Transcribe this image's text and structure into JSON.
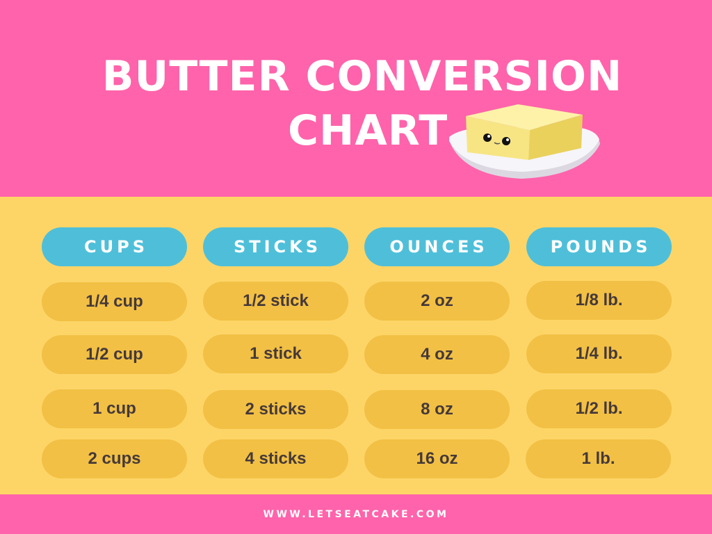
{
  "title": {
    "line1": "BUTTER CONVERSION",
    "line2": "CHART"
  },
  "illustration": "butter-on-plate-icon",
  "colors": {
    "header_bg": "#ff63ab",
    "body_bg": "#fdd567",
    "column_header_bg": "#4fbfd9",
    "cell_bg": "#f2c044",
    "cell_text": "#45393a"
  },
  "table": {
    "columns": [
      "CUPS",
      "STICKS",
      "OUNCES",
      "POUNDS"
    ],
    "rows": [
      [
        "1/4 cup",
        "1/2 stick",
        "2 oz",
        "1/8 lb."
      ],
      [
        "1/2 cup",
        "1 stick",
        "4 oz",
        "1/4 lb."
      ],
      [
        "1 cup",
        "2 sticks",
        "8 oz",
        "1/2 lb."
      ],
      [
        "2 cups",
        "4 sticks",
        "16 oz",
        "1 lb."
      ]
    ]
  },
  "footer": {
    "url": "WWW.LETSEATCAKE.COM"
  }
}
